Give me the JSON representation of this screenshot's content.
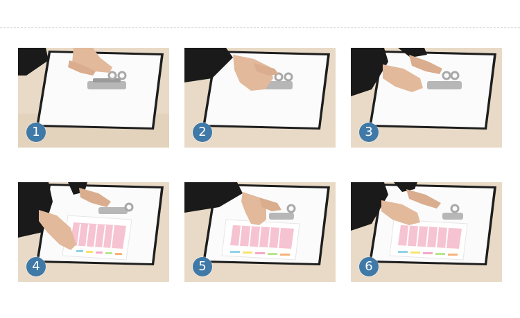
{
  "steps": [
    {
      "number": "1",
      "shows_label_sheet": false
    },
    {
      "number": "2",
      "shows_label_sheet": false
    },
    {
      "number": "3",
      "shows_label_sheet": false
    },
    {
      "number": "4",
      "shows_label_sheet": true
    },
    {
      "number": "5",
      "shows_label_sheet": true
    },
    {
      "number": "6",
      "shows_label_sheet": true
    }
  ],
  "colors": {
    "badge": "#3f79a8",
    "desk": "#e9dcc8",
    "folder_board": "#ffffff",
    "folder_edge": "#1c1c1c",
    "sleeve": "#1a1a1a",
    "skin": "#e6bfa2",
    "label_pink": "#f6c3d2",
    "tab_colors": [
      "#8fd3e8",
      "#f7e36b",
      "#f6a8c6",
      "#b7e58c",
      "#f8b37a"
    ]
  }
}
